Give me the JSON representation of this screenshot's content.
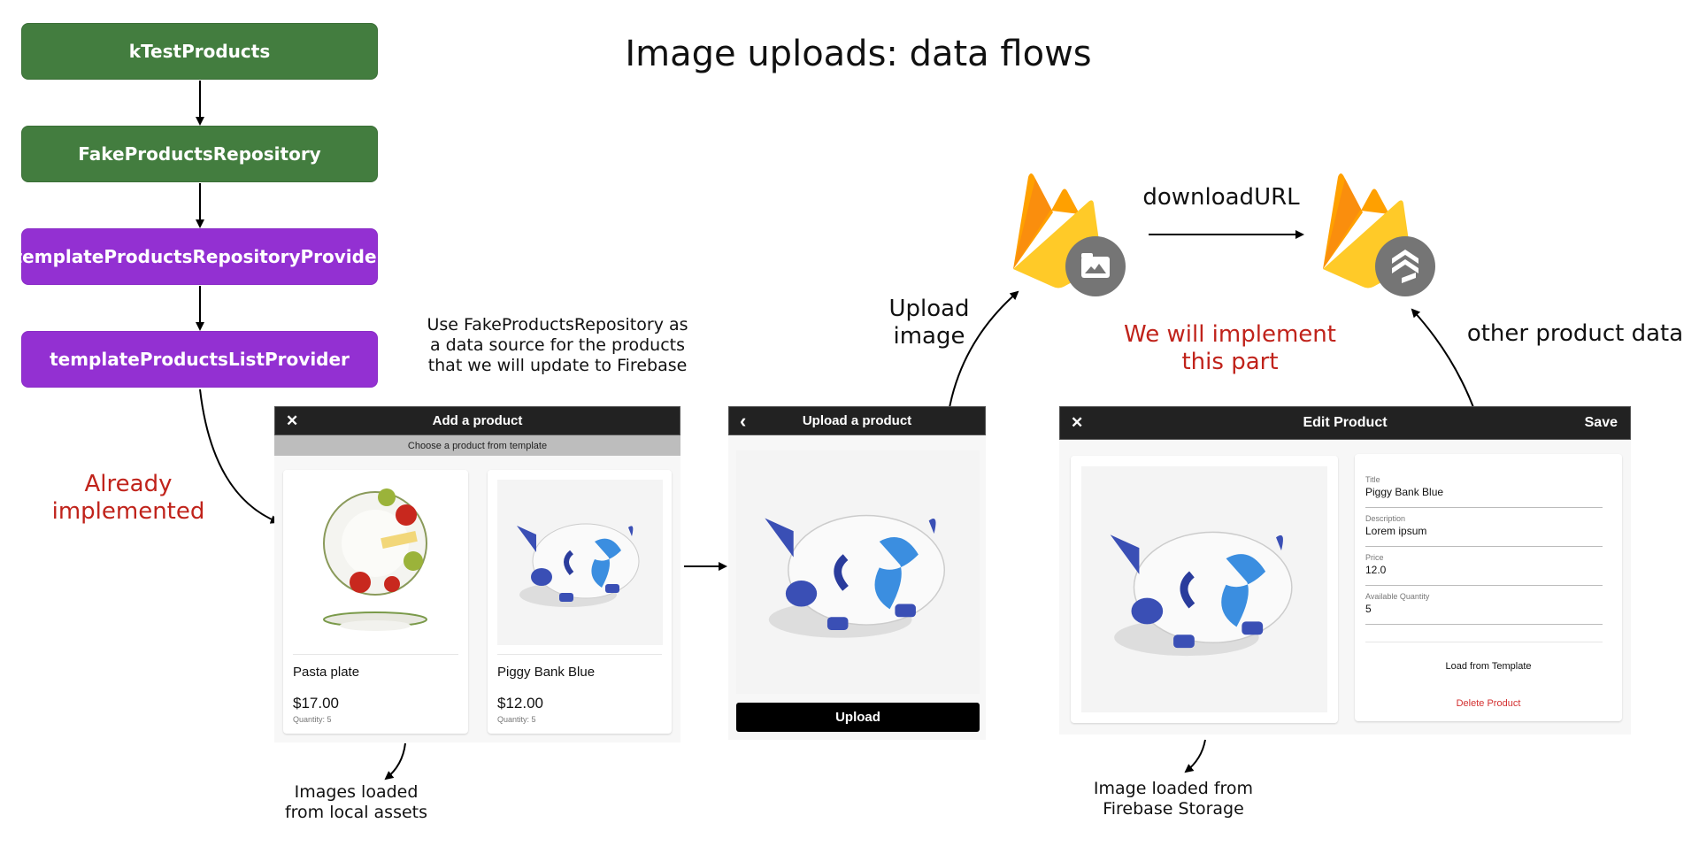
{
  "title": "Image uploads: data flows",
  "flow_boxes": [
    {
      "label": "kTestProducts",
      "color": "#437d3f"
    },
    {
      "label": "FakeProductsRepository",
      "color": "#437d3f"
    },
    {
      "label": "templateProductsRepositoryProvider",
      "color": "#9330d2"
    },
    {
      "label": "templateProductsListProvider",
      "color": "#9330d2"
    }
  ],
  "notes": {
    "use_fake_line1": "Use  FakeProductsRepository as",
    "use_fake_line2": "a data source for the products",
    "use_fake_line3": "that we will update to Firebase",
    "already_line1": "Already",
    "already_line2": "implemented",
    "upload_line1": "Upload",
    "upload_line2": "image",
    "download_url": "downloadURL",
    "implement_line1": "We will implement",
    "implement_line2": "this part",
    "other_data": "other product data",
    "local_line1": "Images loaded",
    "local_line2": "from local assets",
    "storage_line1": "Image loaded from",
    "storage_line2": "Firebase Storage"
  },
  "icons": {
    "firebase_storage": "firebase-storage-icon",
    "firebase_firestore": "firebase-firestore-icon"
  },
  "add_product_screen": {
    "title": "Add a product",
    "close_icon": "✕",
    "subtitle": "Choose a product from template",
    "products": [
      {
        "title": "Pasta plate",
        "price": "$17.00",
        "quantity": "Quantity: 5"
      },
      {
        "title": "Piggy Bank Blue",
        "price": "$12.00",
        "quantity": "Quantity: 5"
      }
    ]
  },
  "upload_screen": {
    "title": "Upload a product",
    "back_icon": "‹",
    "upload_label": "Upload"
  },
  "edit_screen": {
    "title": "Edit Product",
    "close_icon": "✕",
    "save_label": "Save",
    "fields": [
      {
        "label": "Title",
        "value": "Piggy Bank Blue"
      },
      {
        "label": "Description",
        "value": "Lorem ipsum"
      },
      {
        "label": "Price",
        "value": "12.0"
      },
      {
        "label": "Available Quantity",
        "value": "5"
      }
    ],
    "load_template_label": "Load from Template",
    "delete_label": "Delete Product",
    "delete_color": "#d32f2f"
  }
}
